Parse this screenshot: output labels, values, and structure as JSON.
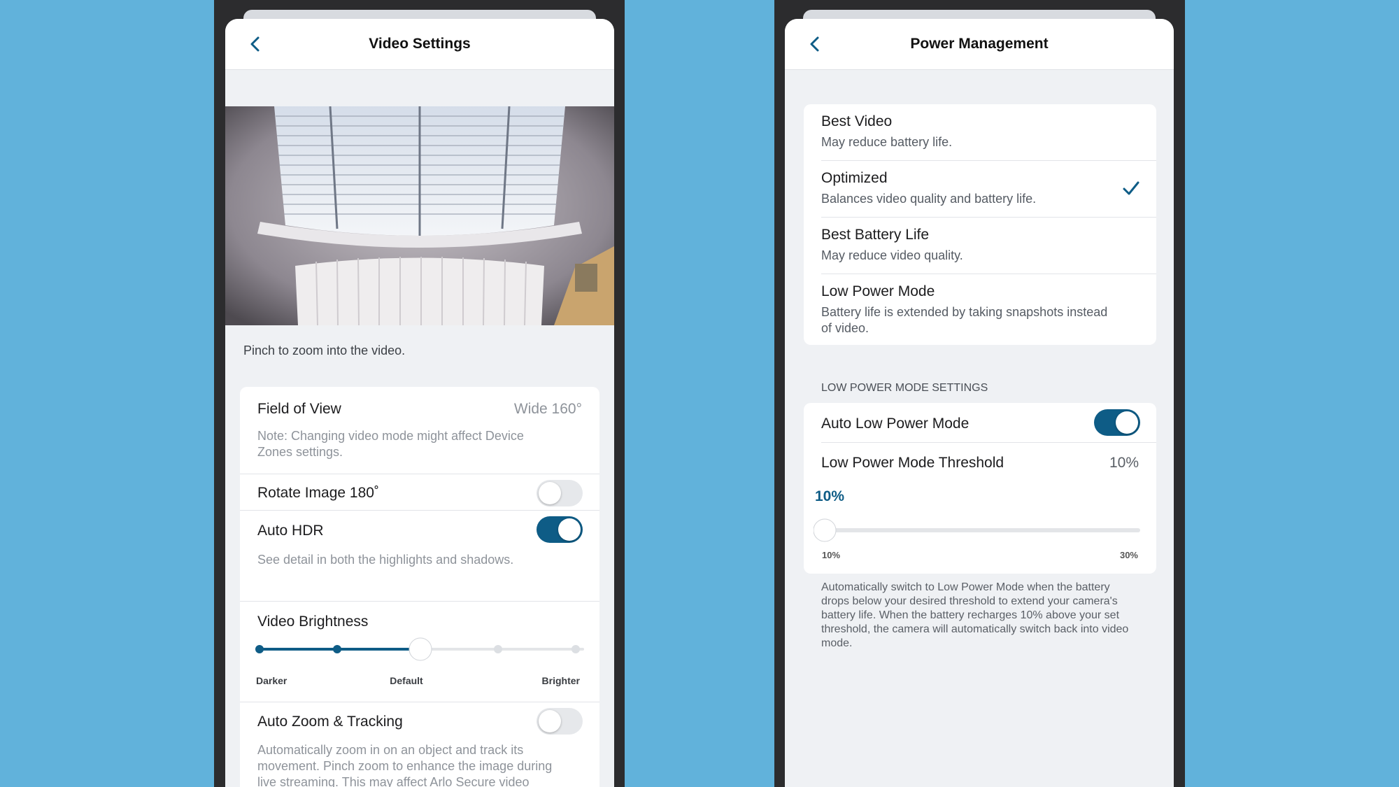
{
  "colors": {
    "background": "#61B2DB",
    "accent": "#0E5C86",
    "frame": "#2C2C2E"
  },
  "video_settings": {
    "title": "Video Settings",
    "back_icon": "chevron-left-icon",
    "preview_image": "camera-preview-room-window-blinds",
    "pinch_hint": "Pinch to zoom into the video.",
    "field_of_view": {
      "label": "Field of View",
      "value": "Wide 160°",
      "note": "Note: Changing video mode might affect Device Zones settings."
    },
    "rotate_image": {
      "label": "Rotate Image 180˚",
      "enabled": false
    },
    "auto_hdr": {
      "label": "Auto HDR",
      "enabled": true,
      "description": "See detail in both the highlights and shadows."
    },
    "video_brightness": {
      "label": "Video Brightness",
      "steps": 5,
      "selected_step": 3,
      "min_label": "Darker",
      "mid_label": "Default",
      "max_label": "Brighter"
    },
    "auto_zoom": {
      "label": "Auto Zoom & Tracking",
      "enabled": false,
      "description": "Automatically zoom in on an object and track its movement. Pinch zoom to enhance the image during live streaming. This may affect Arlo Secure video analysis."
    }
  },
  "power_management": {
    "title": "Power Management",
    "back_icon": "chevron-left-icon",
    "modes": [
      {
        "title": "Best Video",
        "subtitle": "May reduce battery life.",
        "selected": false
      },
      {
        "title": "Optimized",
        "subtitle": "Balances video quality and battery life.",
        "selected": true
      },
      {
        "title": "Best Battery Life",
        "subtitle": "May reduce video quality.",
        "selected": false
      },
      {
        "title": "Low Power Mode",
        "subtitle": "Battery life is extended by taking snapshots instead of video.",
        "selected": false
      }
    ],
    "check_icon": "checkmark-icon",
    "low_power_section_header": "LOW POWER MODE SETTINGS",
    "auto_low_power": {
      "label": "Auto Low Power Mode",
      "enabled": true
    },
    "threshold": {
      "label": "Low Power Mode Threshold",
      "value": "10%",
      "slider_value": "10%",
      "min_label": "10%",
      "max_label": "30%",
      "min": 10,
      "max": 30,
      "current": 10
    },
    "threshold_description": "Automatically switch to Low Power Mode when the battery drops below your desired threshold to extend your camera's battery life. When the battery recharges 10% above your set threshold, the camera will automatically switch back into video mode."
  }
}
